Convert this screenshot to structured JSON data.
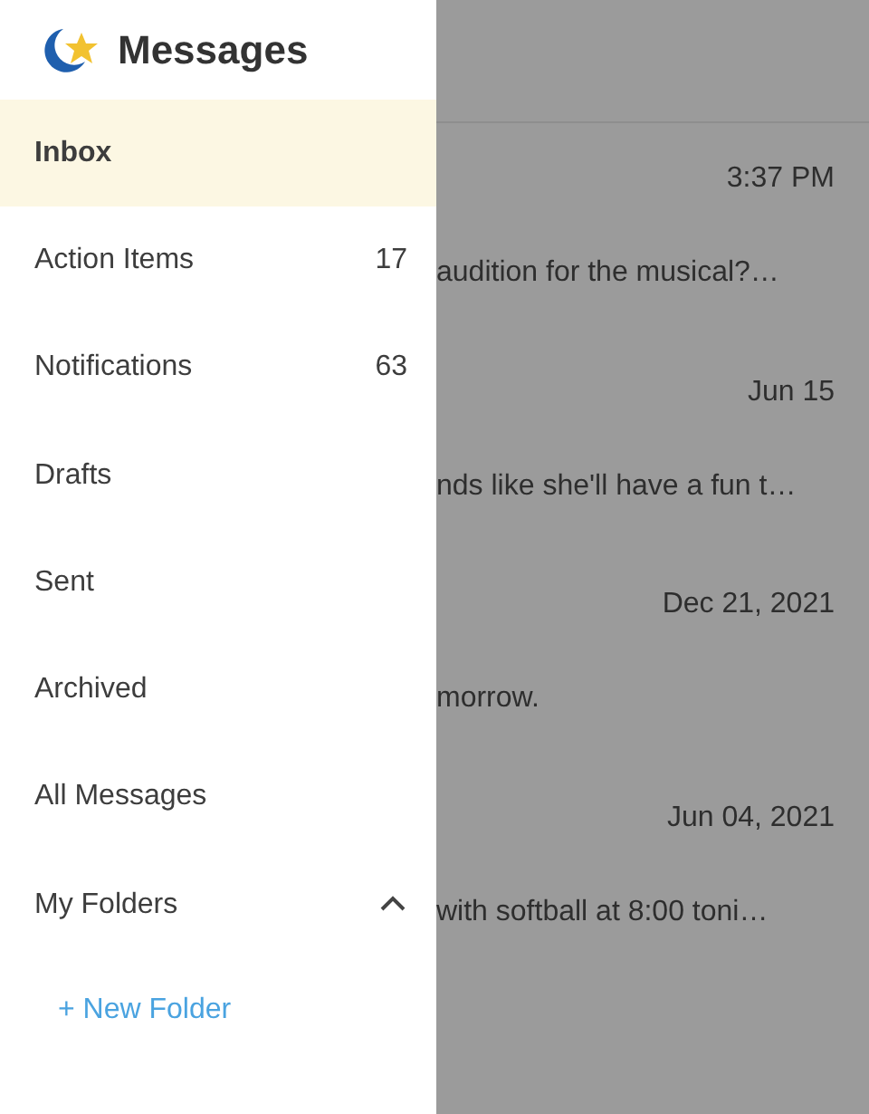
{
  "drawer": {
    "title": "Messages",
    "items": [
      {
        "kind": "folder",
        "label": "Inbox",
        "selected": true
      },
      {
        "kind": "folder",
        "label": "Action Items",
        "count": "17",
        "selected": false
      },
      {
        "kind": "folder",
        "label": "Notifications",
        "count": "63",
        "selected": false
      },
      {
        "kind": "folder",
        "label": "Drafts",
        "selected": false
      },
      {
        "kind": "folder",
        "label": "Sent",
        "selected": false
      },
      {
        "kind": "folder",
        "label": "Archived",
        "selected": false
      },
      {
        "kind": "folder",
        "label": "All Messages",
        "selected": false
      },
      {
        "kind": "section",
        "label": "My Folders",
        "expanded": true,
        "selected": false
      }
    ],
    "new_folder_link": "+ New Folder"
  },
  "messages": [
    {
      "time": "3:37 PM",
      "preview": "audition for the musical?…"
    },
    {
      "time": "Jun 15",
      "preview": "nds like she'll have a fun t…"
    },
    {
      "time": "Dec 21, 2021",
      "preview": "morrow."
    },
    {
      "time": "Jun 04, 2021",
      "preview": "with softball at 8:00 toni…"
    }
  ]
}
